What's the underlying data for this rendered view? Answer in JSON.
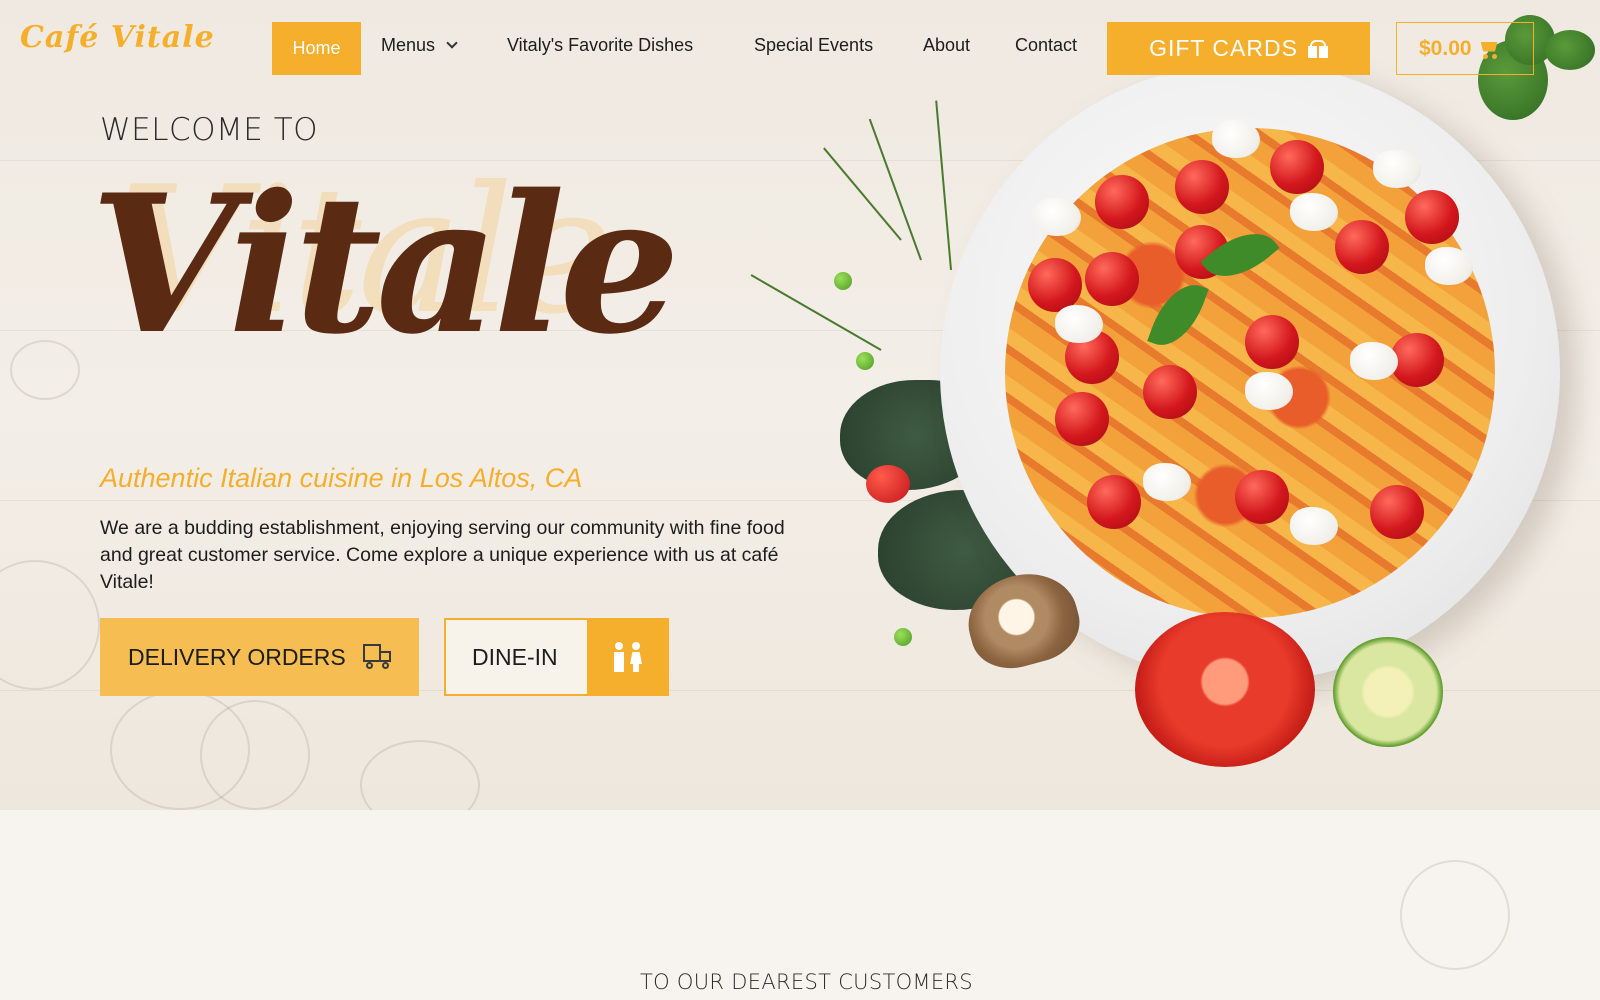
{
  "brand": {
    "logo_text": "Café Vitale",
    "accent_color": "#f6ae2d",
    "brand_brown": "#5b2a12"
  },
  "nav": {
    "home": "Home",
    "menus": "Menus",
    "favorites": "Vitaly's Favorite Dishes",
    "events": "Special Events",
    "about": "About",
    "contact": "Contact",
    "gift_cards": "GIFT CARDS",
    "cart_total": "$0.00"
  },
  "hero": {
    "welcome": "WELCOME TO",
    "title": "Vitale",
    "tagline": "Authentic Italian cuisine in Los Altos, CA",
    "description": "We are a budding establishment, enjoying serving our community with fine food and great customer service. Come explore a unique experience with us at café Vitale!",
    "delivery_button": "DELIVERY ORDERS",
    "dinein_button": "DINE-IN"
  },
  "icons": {
    "gift": "gift-icon",
    "cart": "cart-icon",
    "truck": "delivery-truck-icon",
    "people": "restroom-people-icon",
    "chevron": "chevron-down-icon"
  },
  "section": {
    "heading": "TO OUR DEAREST CUSTOMERS"
  }
}
